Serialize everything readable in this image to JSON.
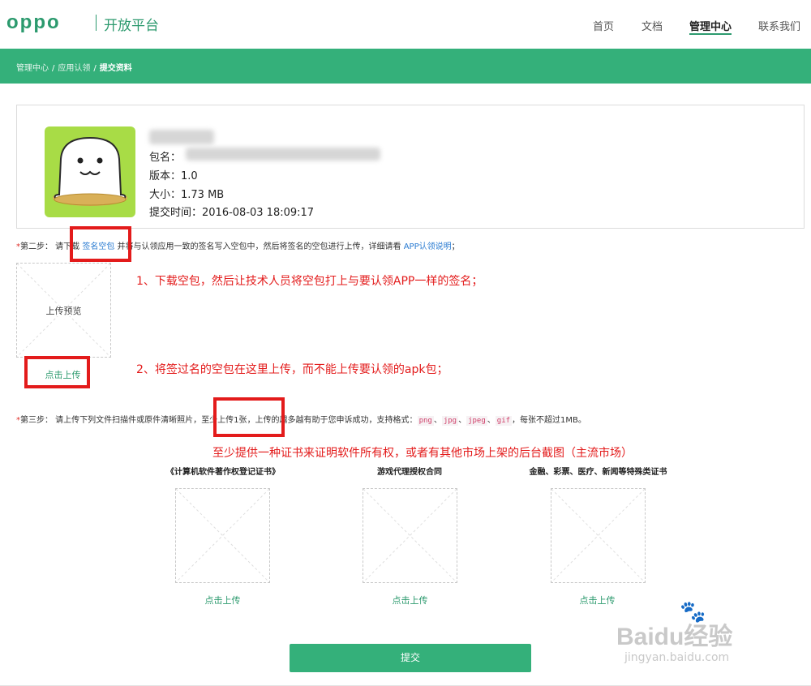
{
  "header": {
    "logo": "oppo",
    "platform": "开放平台",
    "nav": [
      "首页",
      "文档",
      "管理中心",
      "联系我们"
    ],
    "active_nav": "管理中心"
  },
  "breadcrumb": [
    "管理中心",
    "应用认领",
    "提交资料"
  ],
  "app": {
    "package_label": "包名：",
    "version": "版本：1.0",
    "size": "大小：1.73 MB",
    "submitted": "提交时间：2016-08-03 18:09:17"
  },
  "step2": {
    "req": "*",
    "prefix": "第二步：  请下载 ",
    "link1": "签名空包",
    "middle": " 并将与认领应用一致的签名写入空包中，然后将签名的空包进行上传，详细请看 ",
    "link2": "APP认领说明",
    "suffix": "；",
    "preview_label": "上传预览",
    "upload": "点击上传"
  },
  "step3": {
    "req": "*",
    "prefix": "第三步：  请上传下列文件扫描件或原件清晰照片，",
    "highlight": "至少上传1张",
    "middle": "，上传的越多越有助于您申诉成功，支持格式：",
    "formats": [
      "png",
      "jpg",
      "jpeg",
      "gif"
    ],
    "sep": "、",
    "suffix": "，每张不超过1MB。"
  },
  "annotations": {
    "a1": "1、下载空包，然后让技术人员将空包打上与要认领APP一样的签名；",
    "a2": "2、将签过名的空包在这里上传，而不能上传要认领的apk包；",
    "a3": "至少提供一种证书来证明软件所有权，或者有其他市场上架的后台截图（主流市场）"
  },
  "certs": [
    {
      "title": "《计算机软件著作权登记证书》",
      "upload": "点击上传"
    },
    {
      "title": "游戏代理授权合同",
      "upload": "点击上传"
    },
    {
      "title": "金融、彩票、医疗、新闻等特殊类证书",
      "upload": "点击上传"
    }
  ],
  "submit_label": "提交",
  "watermark": {
    "brand": "Baidu经验",
    "url": "jingyan.baidu.com"
  },
  "colors": {
    "brand_green": "#34b07a",
    "annotation_red": "#e31b1b",
    "link_blue": "#2a7bd1"
  }
}
